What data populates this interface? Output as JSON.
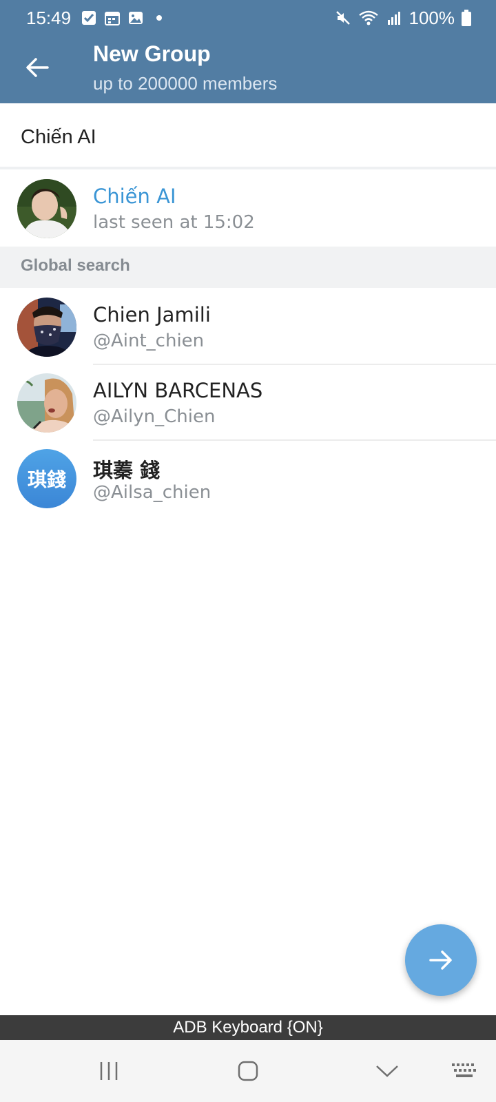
{
  "status_bar": {
    "time": "15:49",
    "battery": "100%",
    "left_icons": [
      "checkbox-notification-icon",
      "calendar-notification-icon",
      "image-notification-icon",
      "dot-icon"
    ],
    "right_icons": [
      "mute-icon",
      "wifi-icon",
      "signal-icon",
      "battery-icon"
    ]
  },
  "header": {
    "title": "New Group",
    "subtitle": "up to 200000 members",
    "background": "#527da3"
  },
  "search": {
    "value": "Chiến AI"
  },
  "contacts": [
    {
      "name": "Chiến AI",
      "status": "last seen at 15:02"
    }
  ],
  "global_search": {
    "label": "Global search",
    "results": [
      {
        "name": "Chien Jamili",
        "username": "@Aint_chien"
      },
      {
        "name": "AILYN BARCENAS",
        "username": "@Ailyn_Chien"
      },
      {
        "name": "琪蓁 錢",
        "username": "@Ailsa_chien",
        "avatar_initials": "琪錢"
      }
    ]
  },
  "fab": {
    "icon": "arrow-right-icon"
  },
  "adb_bar": {
    "text": "ADB Keyboard {ON}"
  },
  "nav_bar": {
    "icons": [
      "recents-icon",
      "home-icon",
      "back-chevron-icon",
      "keyboard-icon"
    ]
  },
  "colors": {
    "accent": "#3a95d5",
    "fab": "#65a9e0",
    "section_bg": "#f1f2f3"
  }
}
